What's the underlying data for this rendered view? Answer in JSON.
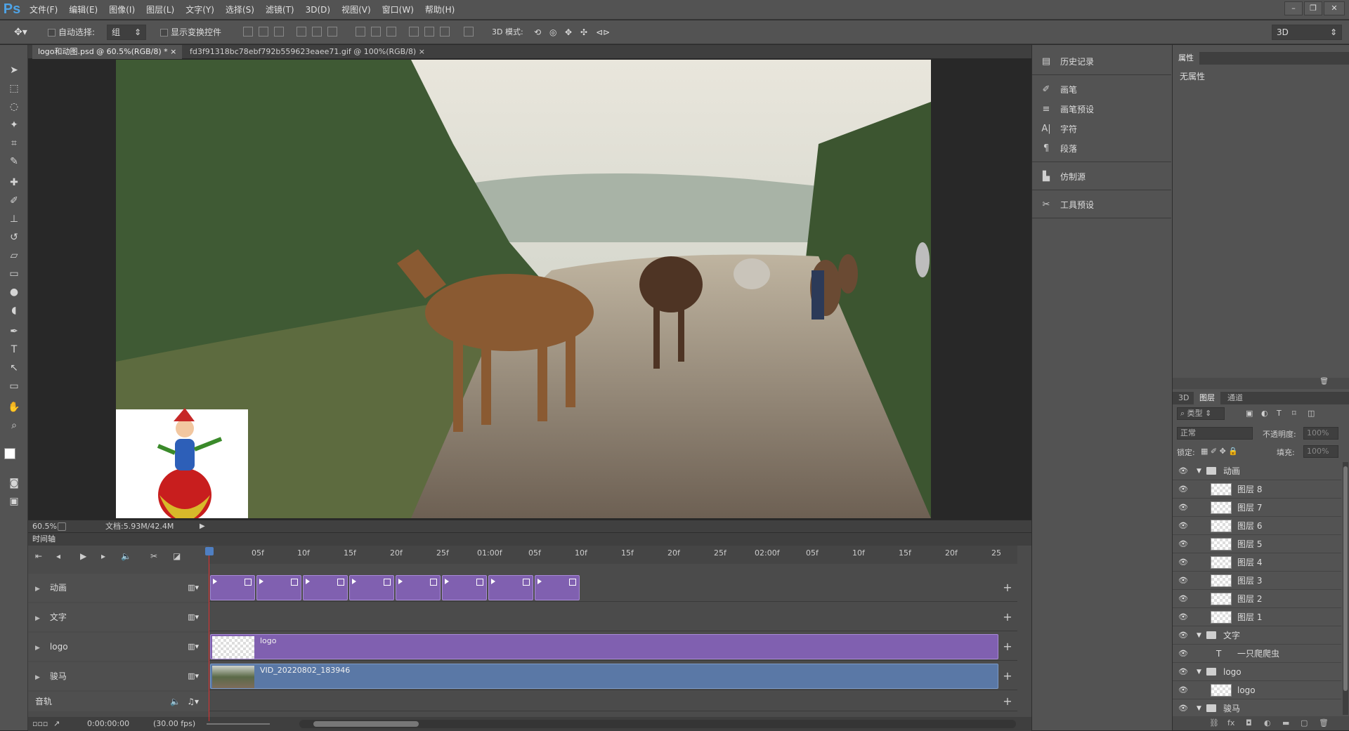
{
  "app": {
    "logo": "Ps"
  },
  "menu": [
    "文件(F)",
    "编辑(E)",
    "图像(I)",
    "图层(L)",
    "文字(Y)",
    "选择(S)",
    "滤镜(T)",
    "3D(D)",
    "视图(V)",
    "窗口(W)",
    "帮助(H)"
  ],
  "window_controls": {
    "minimize": "–",
    "restore": "❐",
    "close": "✕"
  },
  "options": {
    "auto_select_label": "自动选择:",
    "auto_select_value": "组",
    "show_transform_label": "显示变换控件",
    "mode_label": "3D 模式:",
    "workspace": "3D"
  },
  "tabs": [
    {
      "label": "logo和动图.psd @ 60.5%(RGB/8) *",
      "close": "×"
    },
    {
      "label": "fd3f91318bc78ebf792b559623eaee71.gif @ 100%(RGB/8)",
      "close": "×"
    }
  ],
  "status": {
    "zoom": "60.5%",
    "doc": "文档:5.93M/42.4M"
  },
  "timeline": {
    "title": "时间轴",
    "ruler": [
      "05f",
      "10f",
      "15f",
      "20f",
      "25f",
      "01:00f",
      "05f",
      "10f",
      "15f",
      "20f",
      "25f",
      "02:00f",
      "05f",
      "10f",
      "15f",
      "20f",
      "25"
    ],
    "tracks": [
      {
        "name": "动画"
      },
      {
        "name": "文字"
      },
      {
        "name": "logo",
        "clip": "logo"
      },
      {
        "name": "骏马",
        "clip": "VID_20220802_183946"
      }
    ],
    "audio_label": "音轨",
    "timecode": "0:00:00:00",
    "fps": "(30.00 fps)"
  },
  "panel1": {
    "items": [
      "历史记录",
      "画笔",
      "画笔预设",
      "字符",
      "段落",
      "仿制源",
      "工具预设"
    ]
  },
  "properties": {
    "tab": "属性",
    "value": "无属性"
  },
  "layers_panel": {
    "tabs": [
      "3D",
      "图层",
      "通道"
    ],
    "filter": "类型",
    "blend": "正常",
    "opacity_label": "不透明度:",
    "opacity": "100%",
    "lock_label": "锁定:",
    "fill_label": "填充:",
    "fill": "100%",
    "layers": [
      {
        "name": "动画",
        "type": "group"
      },
      {
        "name": "图层 8",
        "type": "layer"
      },
      {
        "name": "图层 7",
        "type": "layer"
      },
      {
        "name": "图层 6",
        "type": "layer"
      },
      {
        "name": "图层 5",
        "type": "layer"
      },
      {
        "name": "图层 4",
        "type": "layer"
      },
      {
        "name": "图层 3",
        "type": "layer"
      },
      {
        "name": "图层 2",
        "type": "layer"
      },
      {
        "name": "图层 1",
        "type": "layer"
      },
      {
        "name": "文字",
        "type": "group"
      },
      {
        "name": "一只爬爬虫",
        "type": "text"
      },
      {
        "name": "logo",
        "type": "group"
      },
      {
        "name": "logo",
        "type": "layer"
      },
      {
        "name": "骏马",
        "type": "group"
      }
    ]
  },
  "colors": {
    "accent": "#4ea3e6",
    "clip_purple": "#8060b0",
    "clip_blue": "#5a78a6"
  }
}
